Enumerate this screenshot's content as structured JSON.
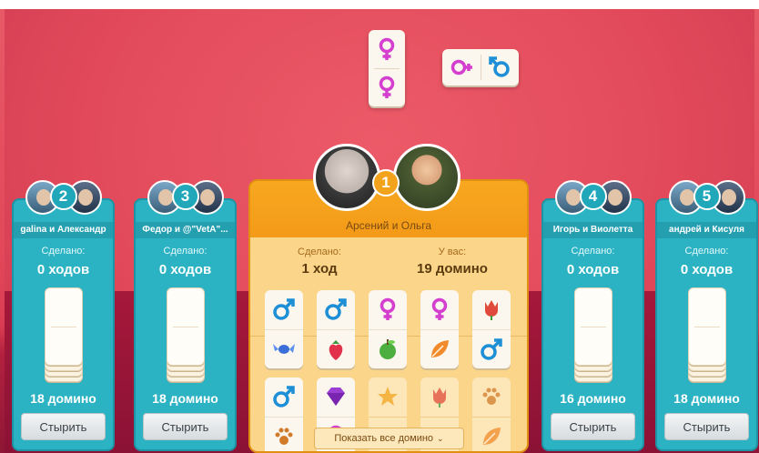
{
  "colors": {
    "female": "#d43fcf",
    "male": "#1d8fd6",
    "teal_panel": "#2bb3c3",
    "orange_panel": "#f6b32a"
  },
  "table": {
    "tiles": [
      {
        "id": "t1",
        "orientation": "vertical",
        "top": "female-icon",
        "bottom": "female-icon"
      },
      {
        "id": "t2",
        "orientation": "horizontal",
        "left": "female-plus-icon",
        "right": "male-reversed-icon"
      }
    ]
  },
  "current_player": {
    "number": "1",
    "name": "Арсений и Ольга",
    "done_label": "Сделано:",
    "done_value": "1 ход",
    "have_label": "У вас:",
    "have_value": "19 домино",
    "hand": [
      {
        "top": "male-icon",
        "bottom": "candy-icon",
        "dim": false
      },
      {
        "top": "male-icon",
        "bottom": "strawberry-icon",
        "dim": false
      },
      {
        "top": "female-icon",
        "bottom": "apple-icon",
        "dim": false
      },
      {
        "top": "female-icon",
        "bottom": "leaf-icon",
        "dim": false
      },
      {
        "top": "tulip-icon",
        "bottom": "male-icon",
        "dim": false
      },
      {
        "top": "male-icon",
        "bottom": "paw-icon",
        "dim": false
      },
      {
        "top": "diamond-icon",
        "bottom": "female-icon",
        "dim": false
      },
      {
        "top": "star-icon",
        "bottom": "leaf-icon",
        "dim": true
      },
      {
        "top": "tulip-icon",
        "bottom": "leaf-icon",
        "dim": true
      },
      {
        "top": "paw-icon",
        "bottom": "leaf-icon",
        "dim": true
      }
    ],
    "show_all_label": "Показать все домино"
  },
  "players": [
    {
      "number": "2",
      "name": "galina и Александр",
      "done_label": "Сделано:",
      "moves": "0 ходов",
      "count": "18 домино",
      "button": "Стырить"
    },
    {
      "number": "3",
      "name": "Федор и @\"VetA\"...",
      "done_label": "Сделано:",
      "moves": "0 ходов",
      "count": "18 домино",
      "button": "Стырить"
    },
    {
      "number": "4",
      "name": "Игорь и Виолетта",
      "done_label": "Сделано:",
      "moves": "0 ходов",
      "count": "16 домино",
      "button": "Стырить"
    },
    {
      "number": "5",
      "name": "андрей и Кисуля",
      "done_label": "Сделано:",
      "moves": "0 ходов",
      "count": "18 домино",
      "button": "Стырить"
    }
  ]
}
